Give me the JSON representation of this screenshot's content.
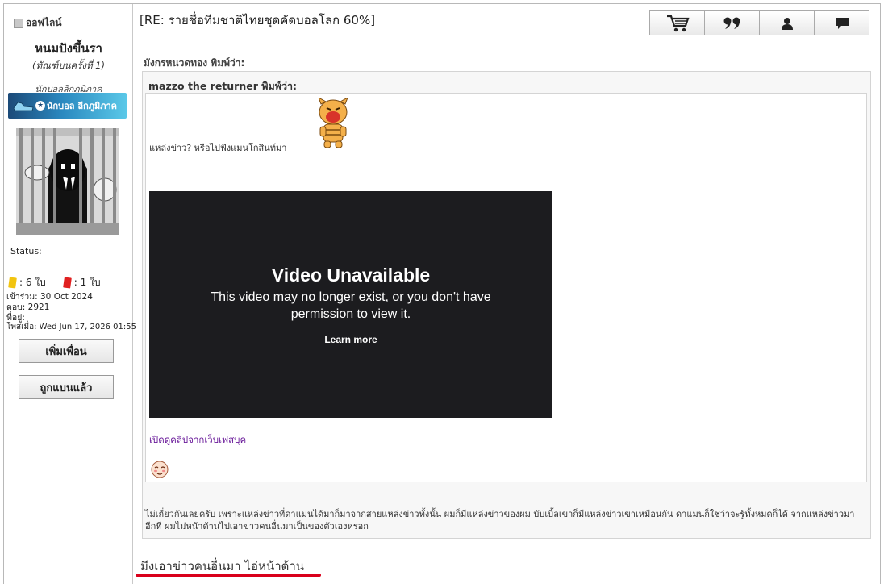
{
  "sidebar": {
    "online_label": "ออฟไลน์",
    "username": "หนมปังขึ้นรา",
    "user_title": "(ทัณฑ์บนครั้งที่ 1)",
    "user_rank": "นักบอลลีกภูมิภาค",
    "rank_badge_text": "นักบอล ลีกภูมิภาค",
    "status_label": "Status:",
    "yellow_cards": ": 6 ใบ",
    "red_cards": ": 1 ใบ",
    "joined": "เข้าร่วม: 30 Oct 2024",
    "replies": "ตอบ: 2921",
    "location": "ที่อยู่:",
    "posted": "โพสเมื่อ: Wed Jun 17, 2026 01:55",
    "add_friend_label": "เพิ่มเพื่อน",
    "banned_label": "ถูกแบนแล้ว"
  },
  "post": {
    "title": "[RE: รายชื่อทีมชาติไทยชุดคัดบอลโลก 60%]",
    "outer_quote_author": "มังกรหนวดทอง พิมพ์ว่า:",
    "inner_quote_author": "mazzo the returner พิมพ์ว่า:",
    "inner_quote_text": "แหล่งข่าว? หรือไปฟังแมนโกสินท์มา",
    "video": {
      "title": "Video Unavailable",
      "message": "This video may no longer exist, or you don't have permission to view it.",
      "learn_more": "Learn more"
    },
    "fb_link": "เปิดดูคลิปจากเว็บเฟสบุค",
    "reply_text": "ไม่เกี่ยวกันเลยครับ เพราะแหล่งข่าวที่ดาแมนได้มาก็มาจากสายแหล่งข่าวทั้งนั้น ผมก็มีแหล่งข่าวของผม บับเบิ้ลเขาก็มีแหล่งข่าวเขาเหมือนกัน ดาแมนก็ใช่ว่าจะรู้ทั้งหมดก็ได้ จากแหล่งข่าวมาอีกที ผมไม่หน้าด้านไปเอาข่าวคนอื่นมาเป็นของตัวเองหรอก",
    "signature": "มึงเอาข่าวคนอื่นมา ไอ่หน้าด้าน"
  },
  "toolbar": {
    "icons": [
      "cart-icon",
      "quote-icon",
      "profile-icon",
      "message-icon"
    ]
  },
  "colors": {
    "yellow_card": "#f2c40f",
    "red_card": "#e02020",
    "signature_underline": "#d9001b",
    "fb_link": "#6a1b9a",
    "video_bg": "#1c1c1f"
  }
}
